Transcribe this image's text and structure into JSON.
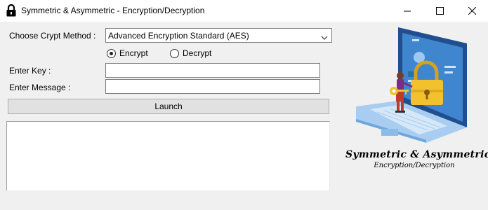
{
  "window": {
    "title": "Symmetric & Asymmetric - Encryption/Decryption"
  },
  "form": {
    "method_label": "Choose Crypt Method :",
    "method_value": "Advanced Encryption Standard (AES)",
    "mode_options": [
      {
        "label": "Encrypt",
        "selected": true
      },
      {
        "label": "Decrypt",
        "selected": false
      }
    ],
    "key_label": "Enter Key :",
    "key_value": "",
    "message_label": "Enter Message :",
    "message_value": "",
    "launch_label": "Launch"
  },
  "output": {
    "text": ""
  },
  "branding": {
    "line1": "Symmetric & Asymmetric",
    "line2": "Encryption/Decryption"
  },
  "icons": {
    "app": "lock-icon",
    "minimize": "minimize-icon",
    "maximize": "maximize-icon",
    "close": "close-icon",
    "dropdown": "chevron-down-icon"
  },
  "colors": {
    "window_bg": "#f0f0f0",
    "titlebar_bg": "#ffffff",
    "button_bg": "#e1e1e1",
    "illustration_blue": "#4a8fd4",
    "lock_yellow": "#f2c12e"
  }
}
